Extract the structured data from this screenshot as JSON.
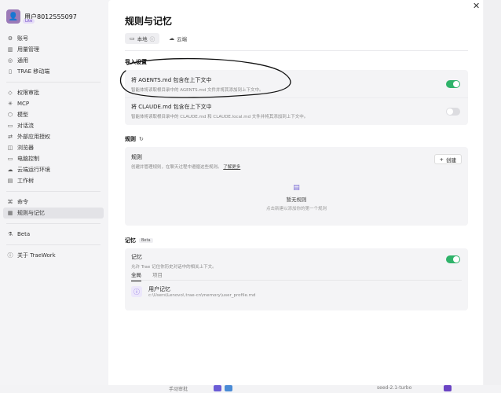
{
  "user": {
    "name": "用户8012555097",
    "badge": "Lite",
    "avatar_icon": "person-icon"
  },
  "sidebar": {
    "items": [
      {
        "icon": "gear-icon",
        "glyph": "⚙",
        "label": "账号"
      },
      {
        "icon": "chart-icon",
        "glyph": "▥",
        "label": "用量管理"
      },
      {
        "icon": "settings-icon",
        "glyph": "◎",
        "label": "通用"
      },
      {
        "icon": "phone-icon",
        "glyph": "▯",
        "label": "TRAE 移动端"
      },
      {
        "icon": "shield-icon",
        "glyph": "◇",
        "label": "权限审批"
      },
      {
        "icon": "mcp-icon",
        "glyph": "✳",
        "label": "MCP"
      },
      {
        "icon": "cube-icon",
        "glyph": "⬡",
        "label": "模型"
      },
      {
        "icon": "chat-icon",
        "glyph": "▭",
        "label": "对话流"
      },
      {
        "icon": "share-icon",
        "glyph": "⇄",
        "label": "外部应用授权"
      },
      {
        "icon": "browser-icon",
        "glyph": "◫",
        "label": "浏览器"
      },
      {
        "icon": "monitor-icon",
        "glyph": "▭",
        "label": "电脑控制"
      },
      {
        "icon": "cloud-icon",
        "glyph": "☁",
        "label": "云端运行环境"
      },
      {
        "icon": "folder-icon",
        "glyph": "▤",
        "label": "工作树"
      },
      {
        "icon": "command-icon",
        "glyph": "⌘",
        "label": "命令"
      },
      {
        "icon": "rules-icon",
        "glyph": "▦",
        "label": "规则与记忆"
      },
      {
        "icon": "flask-icon",
        "glyph": "⚗",
        "label": "Beta"
      },
      {
        "icon": "info-icon",
        "glyph": "ⓘ",
        "label": "关于 TraeWork"
      }
    ],
    "active_label": "规则与记忆"
  },
  "main": {
    "title": "规则与记忆",
    "close_glyph": "✕",
    "tabs": [
      {
        "label": "本地",
        "icon": "monitor-icon",
        "glyph": "▭",
        "suffix": "ⓘ"
      },
      {
        "label": "云端",
        "icon": "cloud-icon",
        "glyph": "☁"
      }
    ],
    "import": {
      "title": "导入设置",
      "agents": {
        "title": "将 AGENTS.md 包含在上下文中",
        "desc": "智能体将读取根目录中的 AGENTS.md 文件并将其添加到上下文中。",
        "enabled": true
      },
      "claude": {
        "title": "将 CLAUDE.md 包含在上下文中",
        "desc": "智能体将读取根目录中的 CLAUDE.md 和 CLAUDE.local.md 文件并将其添加到上下文中。",
        "enabled": false
      }
    },
    "rules": {
      "title": "规则",
      "refresh_glyph": "↻",
      "card_title": "规则",
      "card_desc": "创建并管理规则，在聊天过程中遵循这些规则。",
      "learn_more": "了解更多",
      "create_label": "创建",
      "create_glyph": "+",
      "empty_glyph": "▤",
      "empty_title": "暂无规则",
      "empty_desc": "点击新建以添加你的第一个规则"
    },
    "memory": {
      "title": "记忆",
      "badge": "Beta",
      "card_title": "记忆",
      "card_desc": "允许 Trae 记住你历史对话中的相关上下文。",
      "enabled": true,
      "tabs": [
        "全局",
        "项目"
      ],
      "item_title": "用户记忆",
      "item_path": "c:\\Users\\Lenovo\\.trae-cn\\memory\\user_profile.md",
      "item_glyph": "ⓘ"
    }
  },
  "bottom": {
    "left_label": "手动审批",
    "right_label": "seed-2.1-turbo"
  },
  "colors": {
    "toggle_on": "#2fb36a",
    "accent": "#7a6bd6",
    "annotation": "#111111"
  }
}
